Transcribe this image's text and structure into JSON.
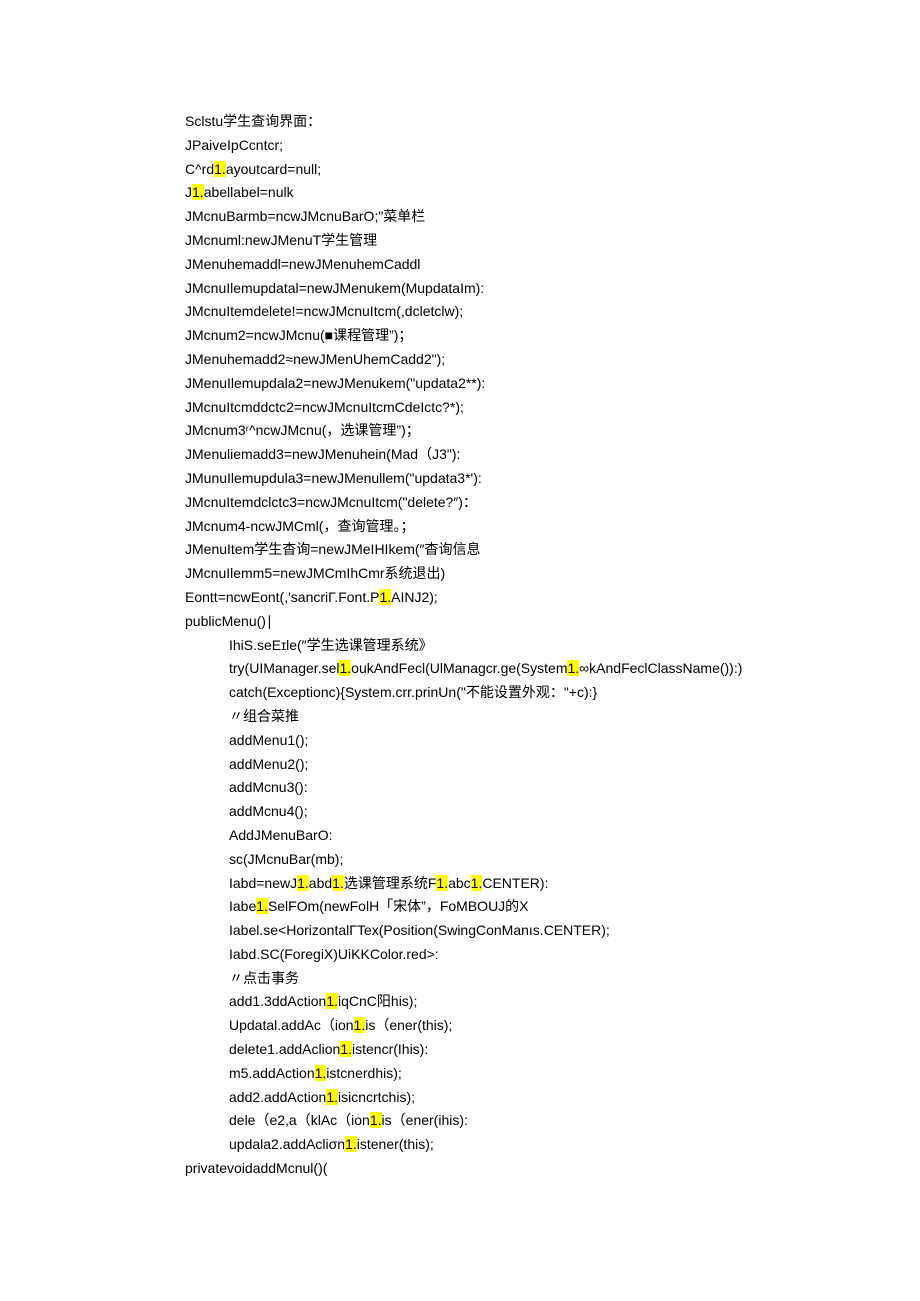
{
  "lines": [
    {
      "indent": 0,
      "segments": [
        {
          "t": "Sclstu学生查询界面：",
          "hl": false
        }
      ]
    },
    {
      "indent": 0,
      "segments": [
        {
          "t": "JPaiveIpCcntcr;",
          "hl": false
        }
      ]
    },
    {
      "indent": 0,
      "segments": [
        {
          "t": "C^rd",
          "hl": false
        },
        {
          "t": "1.",
          "hl": true
        },
        {
          "t": "ayoutcard=null;",
          "hl": false
        }
      ]
    },
    {
      "indent": 0,
      "segments": [
        {
          "t": "J",
          "hl": false
        },
        {
          "t": "1.",
          "hl": true
        },
        {
          "t": "abellabel=nulk",
          "hl": false
        }
      ]
    },
    {
      "indent": 0,
      "segments": [
        {
          "t": "JMcnuBarmb=ncwJMcnuBarO;\"菜单栏",
          "hl": false
        }
      ]
    },
    {
      "indent": 0,
      "segments": [
        {
          "t": "JMcnuml:newJMenuT学生管理",
          "hl": false
        }
      ]
    },
    {
      "indent": 0,
      "segments": [
        {
          "t": "JMenuhemaddl=newJMenuhemCaddl",
          "hl": false
        }
      ]
    },
    {
      "indent": 0,
      "segments": [
        {
          "t": "JMcnuIlemupdatal=newJMenukem(MupdataIm):",
          "hl": false
        }
      ]
    },
    {
      "indent": 0,
      "segments": [
        {
          "t": "JMcnuItemdelete!=ncwJMcnuItcm(,dcletclw);",
          "hl": false
        }
      ]
    },
    {
      "indent": 0,
      "segments": [
        {
          "t": "JMcnum2=ncwJMcnu(■课程管理”)；",
          "hl": false
        }
      ]
    },
    {
      "indent": 0,
      "segments": [
        {
          "t": "JMenuhemadd2≈newJMenUhemCadd2\");",
          "hl": false
        }
      ]
    },
    {
      "indent": 0,
      "segments": [
        {
          "t": "JMenuIlemupdala2=newJMenukem(\"updata2**):",
          "hl": false
        }
      ]
    },
    {
      "indent": 0,
      "segments": [
        {
          "t": "JMcnuItcmddctc2=ncwJMcnuItcmCdeIctc?*);",
          "hl": false
        }
      ]
    },
    {
      "indent": 0,
      "segments": [
        {
          "t": "JMcnum3ʳ^ncwJMcnu(，选课管理”)；",
          "hl": false
        }
      ]
    },
    {
      "indent": 0,
      "segments": [
        {
          "t": "JMenuliemadd3=newJMenuhein(Mad（J3\"):",
          "hl": false
        }
      ]
    },
    {
      "indent": 0,
      "segments": [
        {
          "t": "JMunuIlemupdula3=newJMenullem(\"updata3*'):",
          "hl": false
        }
      ]
    },
    {
      "indent": 0,
      "segments": [
        {
          "t": "JMcnuItemdclctc3=ncwJMcnuItcm(\"delete?″)：",
          "hl": false
        }
      ]
    },
    {
      "indent": 0,
      "segments": [
        {
          "t": "JMcnum4-ncwJMCml(，查询管理。；",
          "hl": false
        }
      ]
    },
    {
      "indent": 0,
      "segments": [
        {
          "t": "JMenuItem学生杳询=newJMeIHIkem(″杳询信息",
          "hl": false
        }
      ]
    },
    {
      "indent": 0,
      "segments": [
        {
          "t": "JMcnuIlemm5=newJMCmIhCmr系统退出)",
          "hl": false
        }
      ]
    },
    {
      "indent": 0,
      "segments": [
        {
          "t": "Eontt=ncwEont(,'sancriΓ.Font.P",
          "hl": false
        },
        {
          "t": "1.",
          "hl": true
        },
        {
          "t": "AINJ2);",
          "hl": false
        }
      ]
    },
    {
      "indent": 0,
      "segments": [
        {
          "t": "publicMenu()∣",
          "hl": false
        }
      ]
    },
    {
      "indent": 1,
      "segments": [
        {
          "t": "IhiS.seEɪle(″学生选课管理系统》",
          "hl": false
        }
      ]
    },
    {
      "indent": 1,
      "segments": [
        {
          "t": "try(UIManager.sel",
          "hl": false
        },
        {
          "t": "1.",
          "hl": true
        },
        {
          "t": "oukAndFecl(UlManagcr.ge(System",
          "hl": false
        },
        {
          "t": "1.",
          "hl": true
        },
        {
          "t": "∞kAndFeclClassName()):)",
          "hl": false
        }
      ]
    },
    {
      "indent": 1,
      "segments": [
        {
          "t": "catch(Exceptionc){System.crr.prinUn(\"不能设置外观：\"+c):}",
          "hl": false
        }
      ]
    },
    {
      "indent": 1,
      "segments": [
        {
          "t": "〃组合菜推",
          "hl": false
        }
      ]
    },
    {
      "indent": 1,
      "segments": [
        {
          "t": "addMenu1();",
          "hl": false
        }
      ]
    },
    {
      "indent": 1,
      "segments": [
        {
          "t": "addMenu2();",
          "hl": false
        }
      ]
    },
    {
      "indent": 1,
      "segments": [
        {
          "t": "addMcnu3():",
          "hl": false
        }
      ]
    },
    {
      "indent": 1,
      "segments": [
        {
          "t": "addMcnu4();",
          "hl": false
        }
      ]
    },
    {
      "indent": 1,
      "segments": [
        {
          "t": "AddJMenuBarO:",
          "hl": false
        }
      ]
    },
    {
      "indent": 1,
      "segments": [
        {
          "t": "sc(JMcnuBar(mb);",
          "hl": false
        }
      ]
    },
    {
      "indent": 1,
      "segments": [
        {
          "t": "Iabd=newJ",
          "hl": false
        },
        {
          "t": "1.",
          "hl": true
        },
        {
          "t": "abd",
          "hl": false
        },
        {
          "t": "1.",
          "hl": true
        },
        {
          "t": "选课管理系统F",
          "hl": false
        },
        {
          "t": "1.",
          "hl": true
        },
        {
          "t": "abc",
          "hl": false
        },
        {
          "t": "1.",
          "hl": true
        },
        {
          "t": "CENTER):",
          "hl": false
        }
      ]
    },
    {
      "indent": 1,
      "segments": [
        {
          "t": "Iabe",
          "hl": false
        },
        {
          "t": "1.",
          "hl": true
        },
        {
          "t": "SelFOm(newFolH「宋体”，FoMBOUJ的X",
          "hl": false
        }
      ]
    },
    {
      "indent": 1,
      "segments": [
        {
          "t": "Iabel.se<HorizontalΓTex(Position(SwingConManıs.CENTER);",
          "hl": false
        }
      ]
    },
    {
      "indent": 1,
      "segments": [
        {
          "t": "Iabd.SC(ForegiX)UiKKColor.red>:",
          "hl": false
        }
      ]
    },
    {
      "indent": 1,
      "segments": [
        {
          "t": "〃点击事务",
          "hl": false
        }
      ]
    },
    {
      "indent": 1,
      "segments": [
        {
          "t": "add1.3ddAction",
          "hl": false
        },
        {
          "t": "1.",
          "hl": true
        },
        {
          "t": "iqCnC阳his);",
          "hl": false
        }
      ]
    },
    {
      "indent": 1,
      "segments": [
        {
          "t": "Updatal.addAc（ion",
          "hl": false
        },
        {
          "t": "1.",
          "hl": true
        },
        {
          "t": "is（ener(this);",
          "hl": false
        }
      ]
    },
    {
      "indent": 1,
      "segments": [
        {
          "t": "delete1.addAclion",
          "hl": false
        },
        {
          "t": "1.",
          "hl": true
        },
        {
          "t": "istencr(Ihis):",
          "hl": false
        }
      ]
    },
    {
      "indent": 1,
      "segments": [
        {
          "t": "m5.addAction",
          "hl": false
        },
        {
          "t": "1.",
          "hl": true
        },
        {
          "t": "istcnerdhis);",
          "hl": false
        }
      ]
    },
    {
      "indent": 1,
      "segments": [
        {
          "t": "add2.addAction",
          "hl": false
        },
        {
          "t": "1.",
          "hl": true
        },
        {
          "t": "isicncrtchis);",
          "hl": false
        }
      ]
    },
    {
      "indent": 1,
      "segments": [
        {
          "t": "dele（e2,a（klAc（ion",
          "hl": false
        },
        {
          "t": "1.",
          "hl": true
        },
        {
          "t": "is（ener(ihis):",
          "hl": false
        }
      ]
    },
    {
      "indent": 1,
      "segments": [
        {
          "t": "updala2.addAcliσn",
          "hl": false
        },
        {
          "t": "1.",
          "hl": true
        },
        {
          "t": "istener(this);",
          "hl": false
        }
      ]
    },
    {
      "indent": 0,
      "segments": [
        {
          "t": "privatevoidaddMcnul()(",
          "hl": false
        }
      ]
    }
  ]
}
